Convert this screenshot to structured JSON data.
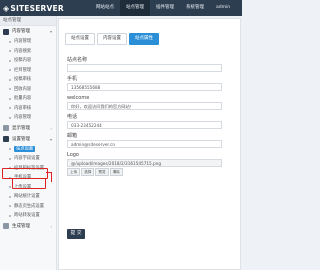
{
  "topbar": {
    "logo": "SITESERVER",
    "nav": [
      {
        "label": "网站站点",
        "active": false
      },
      {
        "label": "站点管理",
        "active": true
      },
      {
        "label": "插件管理",
        "active": false
      },
      {
        "label": "系统管理",
        "active": false
      },
      {
        "label": "admin",
        "active": false
      }
    ]
  },
  "sidebar": {
    "header": "站点管理",
    "content_group": {
      "label": "内容管理",
      "items": [
        "内容管理",
        "内容搜索",
        "投稿内容",
        "栏目管理",
        "投稿审核",
        "回收内容",
        "批量内容",
        "内容审核",
        "内容管理"
      ]
    },
    "display_group": {
      "label": "显示管理"
    },
    "settings_group": {
      "label": "设置管理",
      "items": [
        "站点设置",
        "内容字段设置",
        "栏目和标签设置",
        "手机设置",
        "上传设置",
        "网站统计设置",
        "静态页生成设置",
        "跨站转发设置"
      ]
    },
    "generate_group": {
      "label": "生成管理"
    }
  },
  "tabs": [
    "站点设置",
    "内容设置",
    "站点属性"
  ],
  "form": {
    "name_label": "站点名称",
    "name_value": "",
    "phone_label": "手机",
    "phone_value": "13568555688",
    "welcome_label": "welcome",
    "welcome_value": "你好，欢迎访问我们的官方网站！",
    "tel_label": "电话",
    "tel_value": "033-23452244",
    "email_label": "邮箱",
    "email_value": "admin@siteserver.cn",
    "logo_label": "Logo",
    "logo_value": "@/upload/images/2018/2/3161545715.png",
    "upload_buttons": [
      "上传",
      "选择",
      "预览",
      "清除"
    ],
    "save_label": "提 交"
  },
  "colors": {
    "topbar": "#2d3e50",
    "accent": "#2b8fd8",
    "highlight": "#dd2222"
  }
}
